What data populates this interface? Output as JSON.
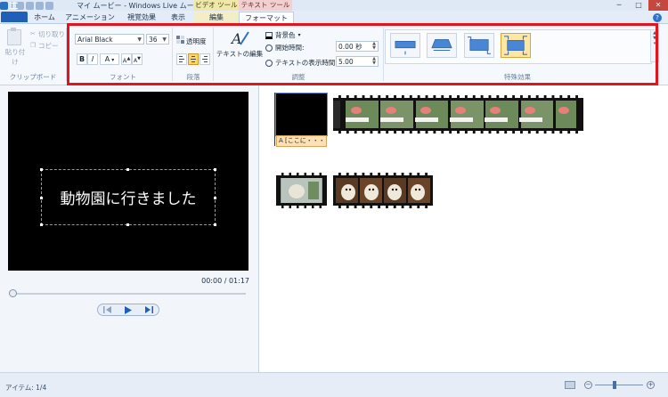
{
  "window": {
    "title": "マイ ムービー - Windows Live ムービー ...",
    "context_video_tools": "ビデオ ツール",
    "context_text_tools": "テキスト ツール",
    "minimize": "─",
    "maximize": "□",
    "close": "✕"
  },
  "tabs": {
    "home": "ホーム",
    "animation": "アニメーション",
    "visual_effects": "視覚効果",
    "view": "表示",
    "edit": "編集",
    "format": "フォーマット"
  },
  "ribbon": {
    "clipboard": {
      "paste": "貼り付け",
      "cut": "切り取り",
      "copy": "コピー",
      "group_label": "クリップボード"
    },
    "font": {
      "name": "Arial Black",
      "size": "36",
      "bold": "B",
      "italic": "I",
      "font_color": "A",
      "grow": "A",
      "shrink": "A",
      "group_label": "フォント"
    },
    "paragraph": {
      "transparency": "透明度",
      "group_label": "段落"
    },
    "adjust": {
      "text_edit": "テキストの編集",
      "background_color": "背景色",
      "start_time_label": "開始時間:",
      "start_time_value": "0.00 秒",
      "duration_label": "テキストの表示時間:",
      "duration_value": "5.00",
      "group_label": "調整"
    },
    "effects": {
      "group_label": "特殊効果"
    }
  },
  "preview": {
    "caption": "動物園に行きました",
    "timecode": "00:00 / 01:17"
  },
  "storyboard": {
    "caption_chip": "A [ここに・・・"
  },
  "status": {
    "items": "アイテム: 1/4"
  },
  "colors": {
    "highlight": "#e3141c",
    "accent": "#1f5fb8",
    "selected_effect": "#fde7a6"
  }
}
